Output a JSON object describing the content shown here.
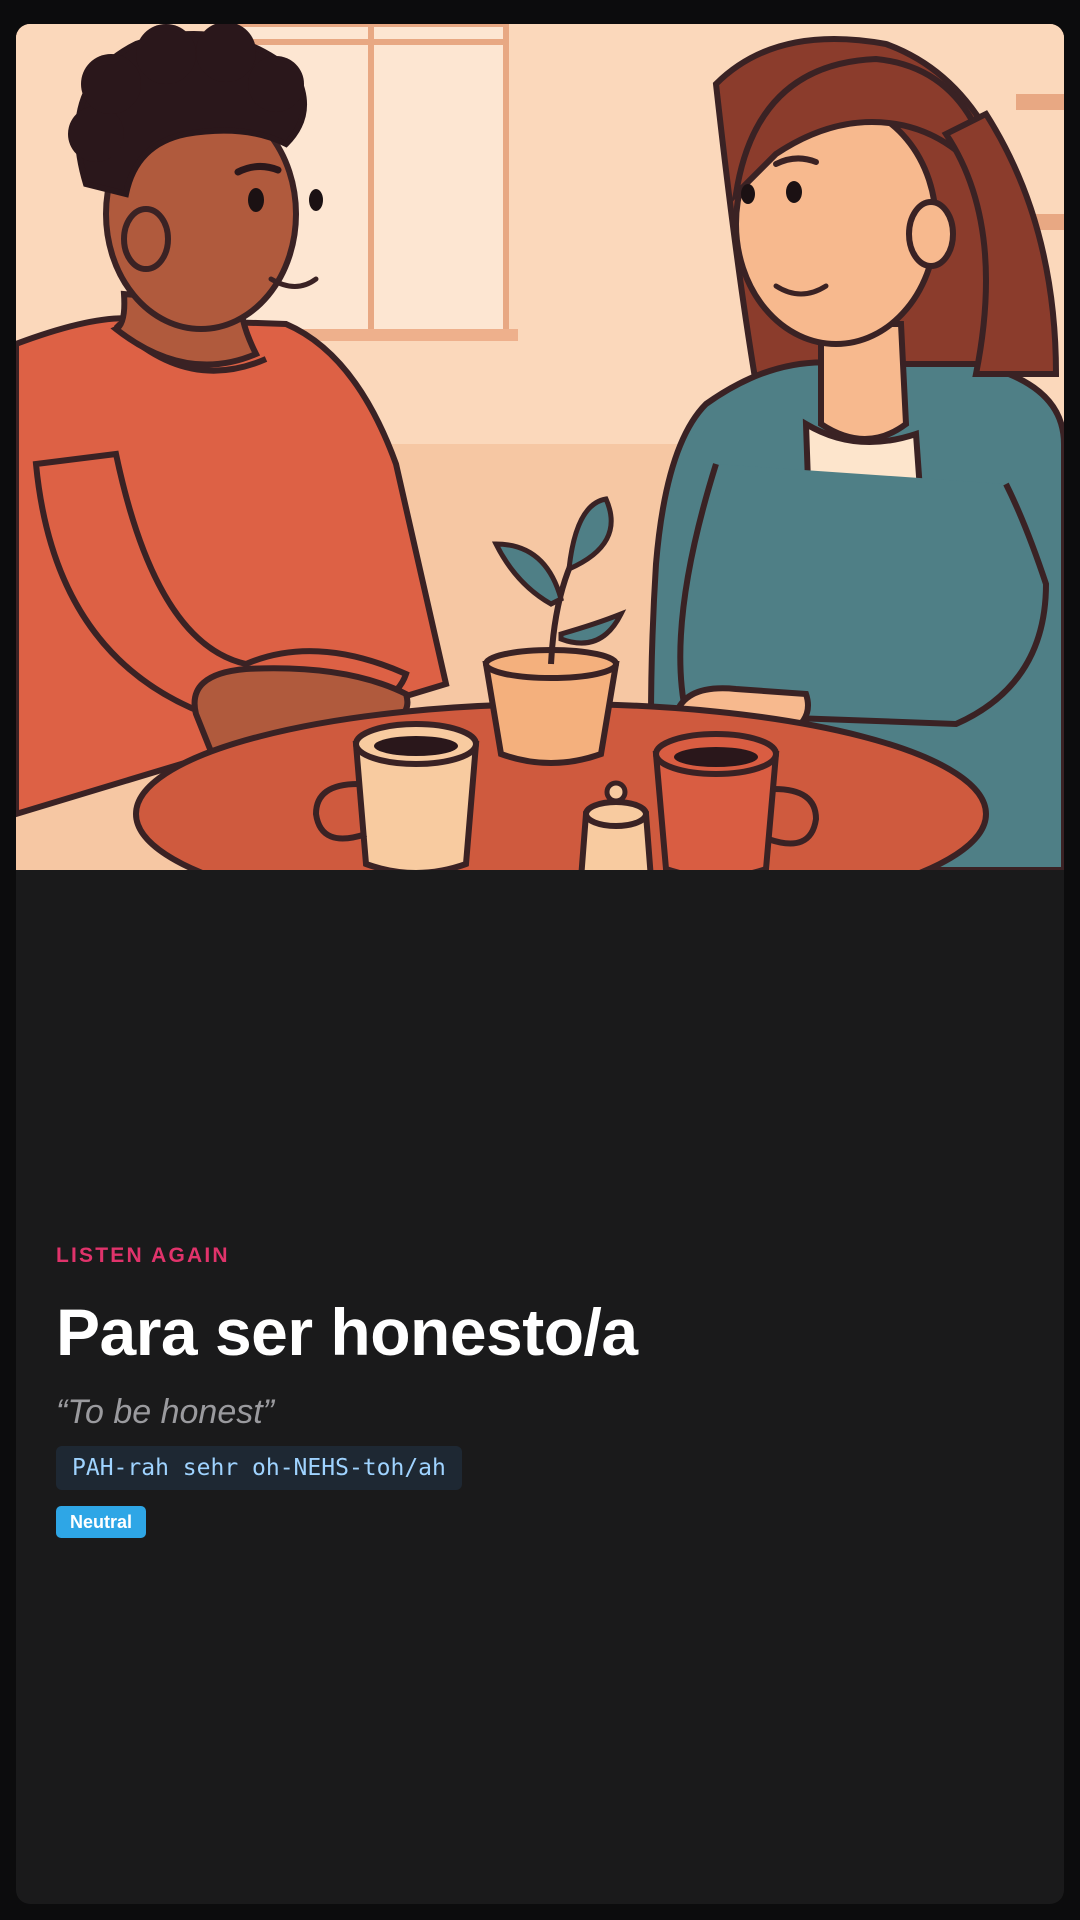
{
  "card": {
    "eyebrow": "LISTEN AGAIN",
    "phrase": "Para ser honesto/a",
    "translation": "“To be honest”",
    "pronunciation": "PAH-rah sehr oh-NEHS-toh/ah",
    "register_tag": "Neutral"
  },
  "colors": {
    "eyebrow": "#e0336b",
    "tag": "#2ea6e6",
    "card_background": "#1a1a1b"
  },
  "illustration": {
    "subject": "two people talking over coffee at a cafe table"
  }
}
